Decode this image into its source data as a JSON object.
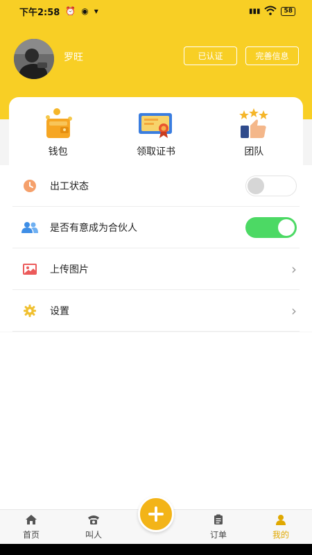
{
  "status_bar": {
    "time": "下午2:58",
    "battery": "58"
  },
  "profile": {
    "username": "罗旺",
    "verified_label": "已认证",
    "complete_label": "完善信息"
  },
  "quick_links": [
    {
      "label": "钱包",
      "icon": "wallet-icon"
    },
    {
      "label": "领取证书",
      "icon": "certificate-icon"
    },
    {
      "label": "团队",
      "icon": "team-icon"
    }
  ],
  "settings_list": [
    {
      "label": "出工状态",
      "icon": "clock-icon",
      "control": "toggle",
      "on": false
    },
    {
      "label": "是否有意成为合伙人",
      "icon": "people-icon",
      "control": "toggle",
      "on": true
    },
    {
      "label": "上传图片",
      "icon": "image-icon",
      "control": "chevron"
    },
    {
      "label": "设置",
      "icon": "gear-icon",
      "control": "chevron"
    }
  ],
  "tabbar": {
    "home": "首页",
    "call": "叫人",
    "orders": "订单",
    "mine": "我的"
  },
  "colors": {
    "brand_yellow": "#f8cf25",
    "toggle_on": "#4cd964",
    "active_tab": "#e0a800"
  }
}
